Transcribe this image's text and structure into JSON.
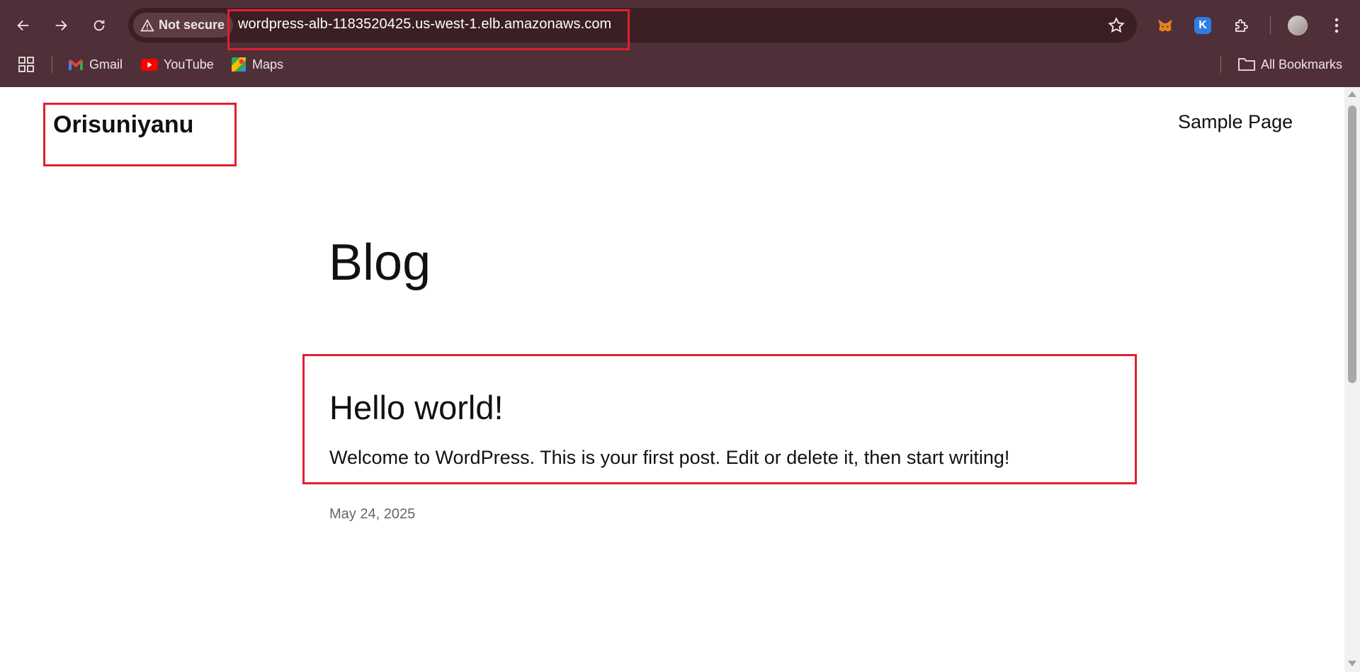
{
  "browser": {
    "security_label": "Not secure",
    "url": "wordpress-alb-1183520425.us-west-1.elb.amazonaws.com",
    "extension_letter": "K"
  },
  "bookmarks": {
    "items": [
      {
        "label": "Gmail"
      },
      {
        "label": "YouTube"
      },
      {
        "label": "Maps"
      }
    ],
    "all_bookmarks_label": "All Bookmarks"
  },
  "site": {
    "title": "Orisuniyanu",
    "nav_link": "Sample Page"
  },
  "main": {
    "heading": "Blog",
    "post": {
      "title": "Hello world!",
      "excerpt": "Welcome to WordPress. This is your first post. Edit or delete it, then start writing!",
      "date": "May 24, 2025"
    }
  },
  "colors": {
    "chrome_bg": "#4f3038",
    "omnibox_bg": "#3a1f23",
    "highlight": "#e02030"
  }
}
